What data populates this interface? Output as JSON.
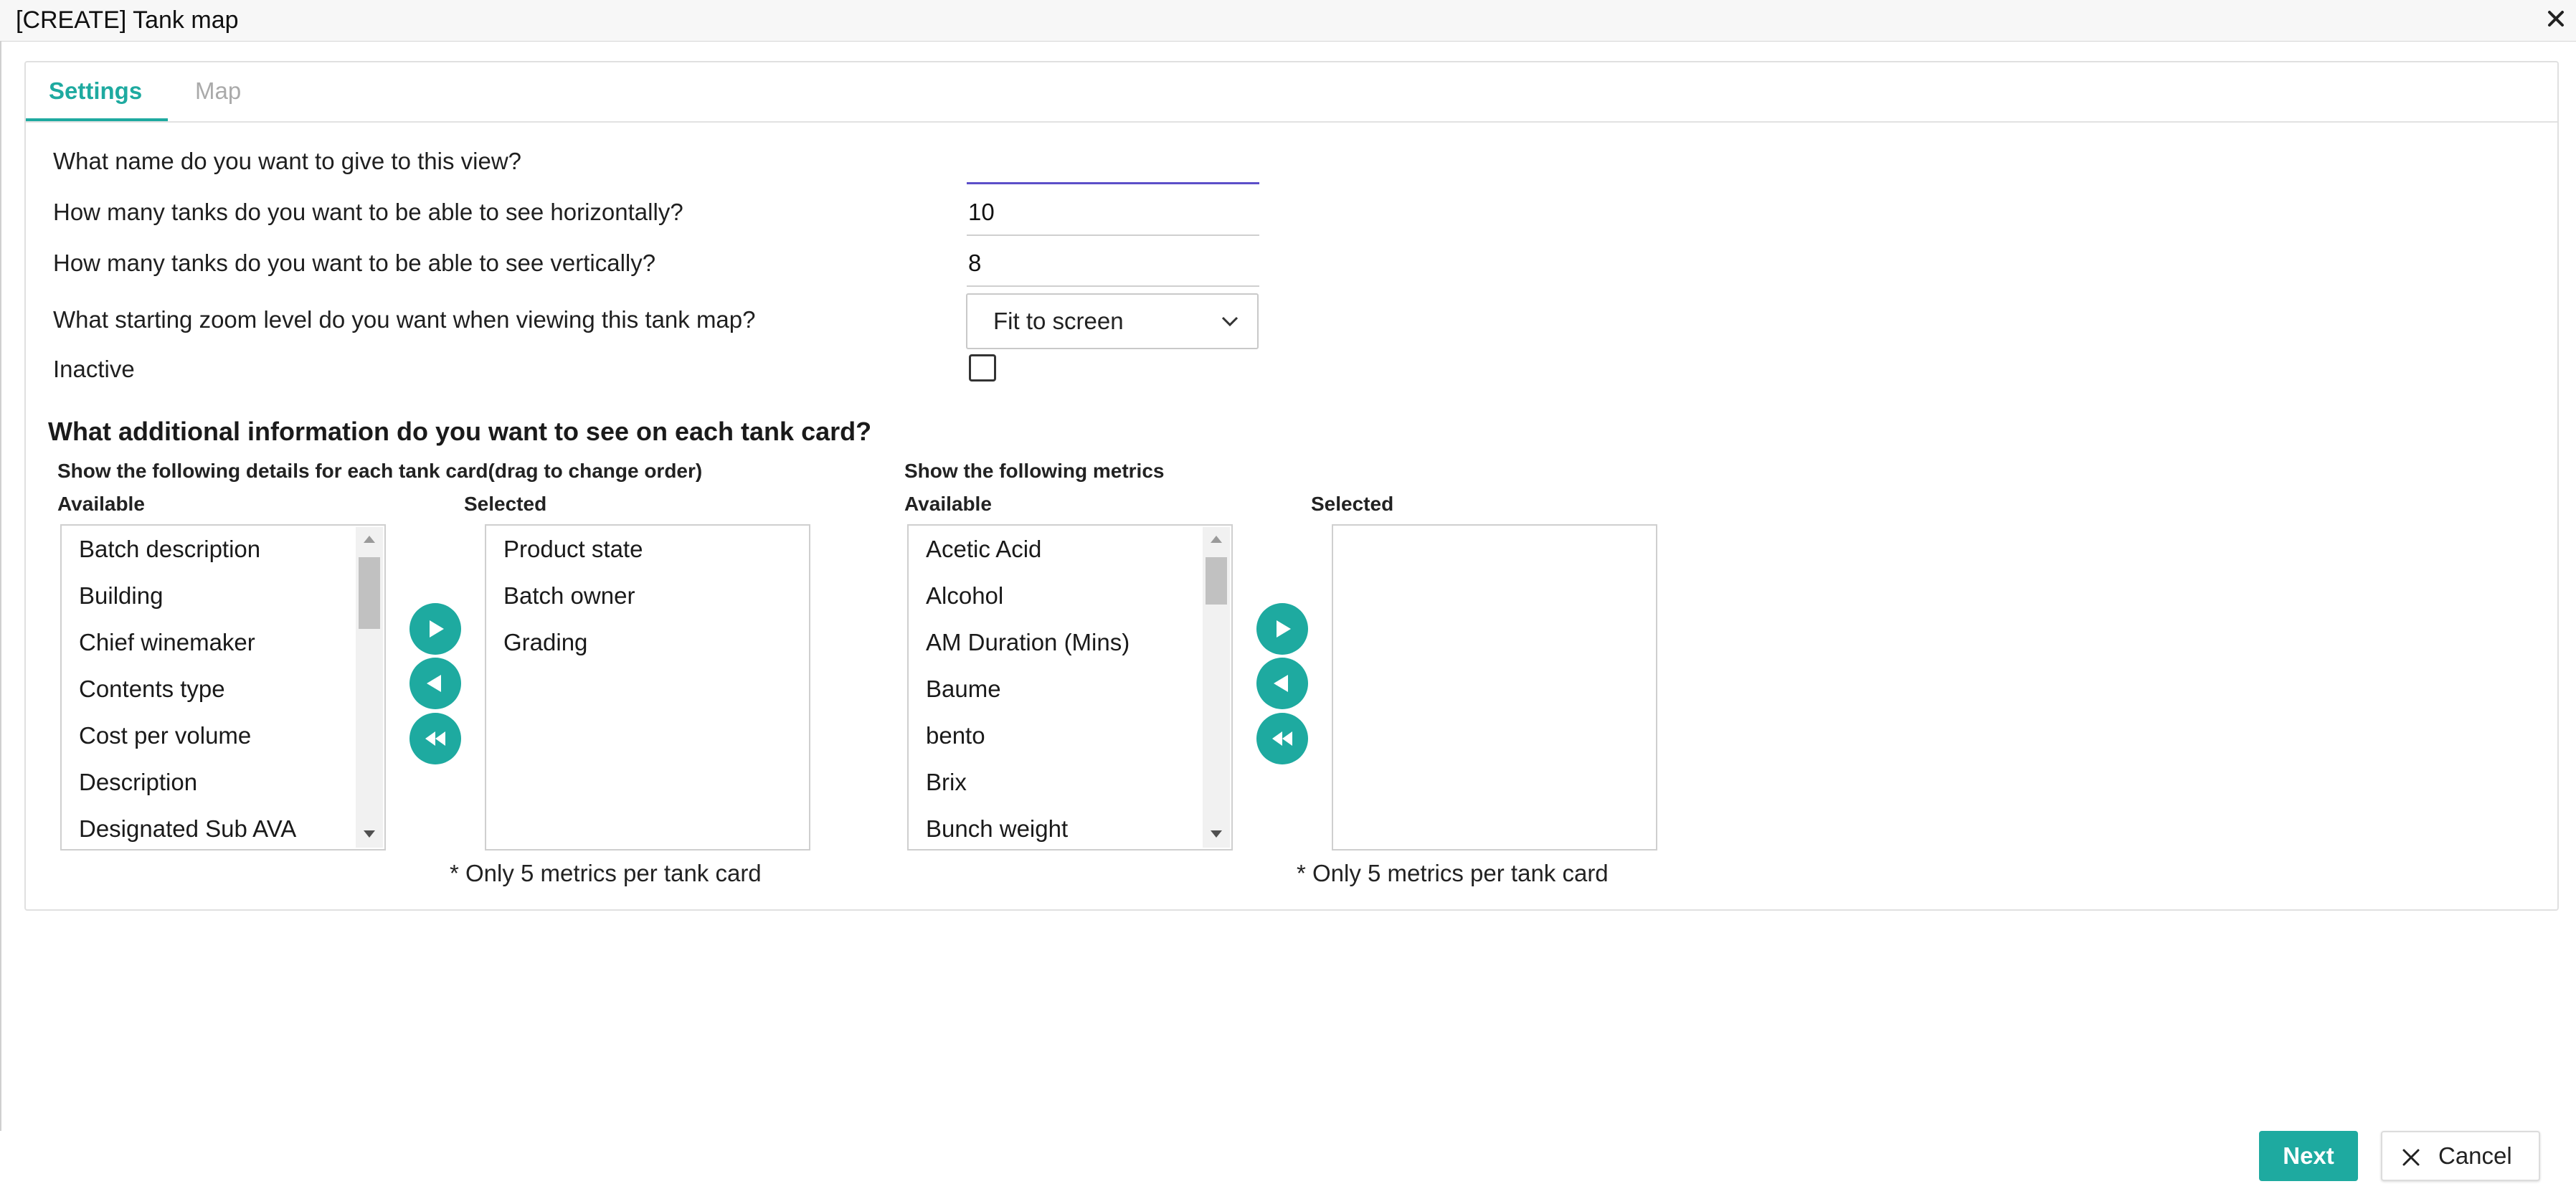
{
  "window": {
    "title": "[CREATE] Tank map"
  },
  "tabs": [
    {
      "label": "Settings"
    },
    {
      "label": "Map"
    }
  ],
  "form": {
    "name_label": "What name do you want to give to this view?",
    "name_value": "",
    "horizontal_label": "How many tanks do you want to be able to see horizontally?",
    "horizontal_value": "10",
    "vertical_label": "How many tanks do you want to be able to see vertically?",
    "vertical_value": "8",
    "zoom_label": "What starting zoom level do you want when viewing this tank map?",
    "zoom_value": "Fit to screen",
    "inactive_label": "Inactive",
    "inactive_checked": false
  },
  "section_heading": "What additional information do you want to see on each tank card?",
  "details": {
    "heading": "Show the following details for each tank card(drag to change order)",
    "available_label": "Available",
    "selected_label": "Selected",
    "available_items": [
      "Batch description",
      "Building",
      "Chief winemaker",
      "Contents type",
      "Cost per volume",
      "Description",
      "Designated Sub AVA"
    ],
    "selected_items": [
      "Product state",
      "Batch owner",
      "Grading"
    ],
    "note": "* Only 5 metrics per tank card"
  },
  "metrics": {
    "heading": "Show the following metrics",
    "available_label": "Available",
    "selected_label": "Selected",
    "available_items": [
      "Acetic Acid",
      "Alcohol",
      "AM Duration (Mins)",
      "Baume",
      "bento",
      "Brix",
      "Bunch weight"
    ],
    "selected_items": [],
    "note": "* Only 5 metrics per tank card"
  },
  "footer": {
    "next_label": "Next",
    "cancel_label": "Cancel"
  },
  "colors": {
    "accent": "#1eaaa0",
    "focus_underline": "#5c4fc9"
  },
  "icons": [
    "close-icon",
    "chevron-down-icon",
    "move-right-icon",
    "move-left-icon",
    "move-all-left-icon",
    "cancel-x-icon"
  ]
}
